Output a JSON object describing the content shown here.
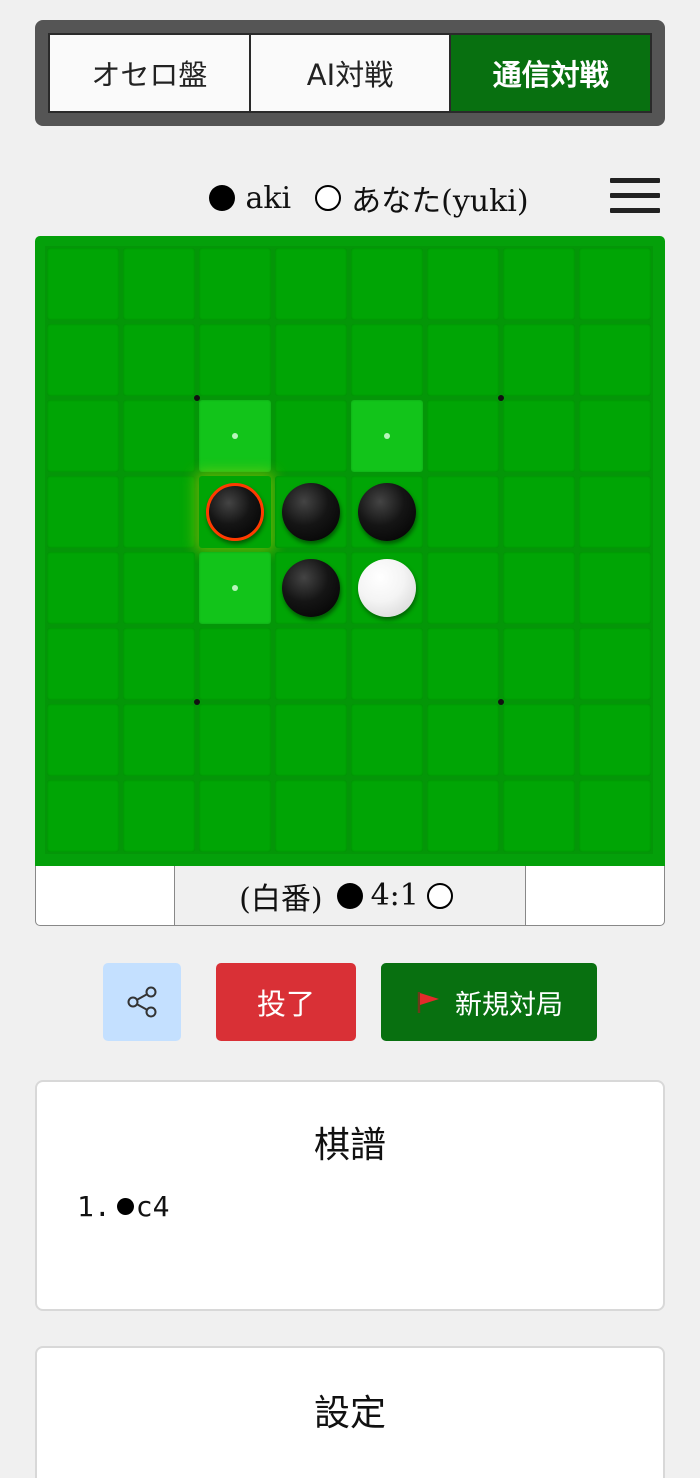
{
  "tabs": [
    {
      "label": "オセロ盤",
      "active": false
    },
    {
      "label": "AI対戦",
      "active": false
    },
    {
      "label": "通信対戦",
      "active": true
    }
  ],
  "players": {
    "black_name": "aki",
    "white_name": "あなた(yuki)"
  },
  "menu_icon": "hamburger-menu-icon",
  "board": {
    "size": 8,
    "black": [
      "c4",
      "d4",
      "e4",
      "d5"
    ],
    "white": [
      "e5"
    ],
    "last_move": "c4",
    "legal_moves": [
      "c3",
      "e3",
      "c5"
    ],
    "star_points": [
      "c3",
      "g3",
      "c7",
      "g7"
    ]
  },
  "score": {
    "turn_label": "(白番)",
    "black": "4",
    "separator": ":",
    "white": "1"
  },
  "actions": {
    "share_icon": "share-icon",
    "resign_label": "投了",
    "new_game_label": "新規対局",
    "new_game_icon": "red-flag-icon"
  },
  "kifu": {
    "title": "棋譜",
    "moves": [
      {
        "number": "1.",
        "color": "black",
        "square": "c4"
      }
    ]
  },
  "settings": {
    "title": "設定"
  },
  "colors": {
    "board_green": "#04a00a",
    "active_tab": "#087010",
    "resign_red": "#d93036",
    "share_blue": "#c4e0ff",
    "last_move_ring": "#ff3b00"
  }
}
